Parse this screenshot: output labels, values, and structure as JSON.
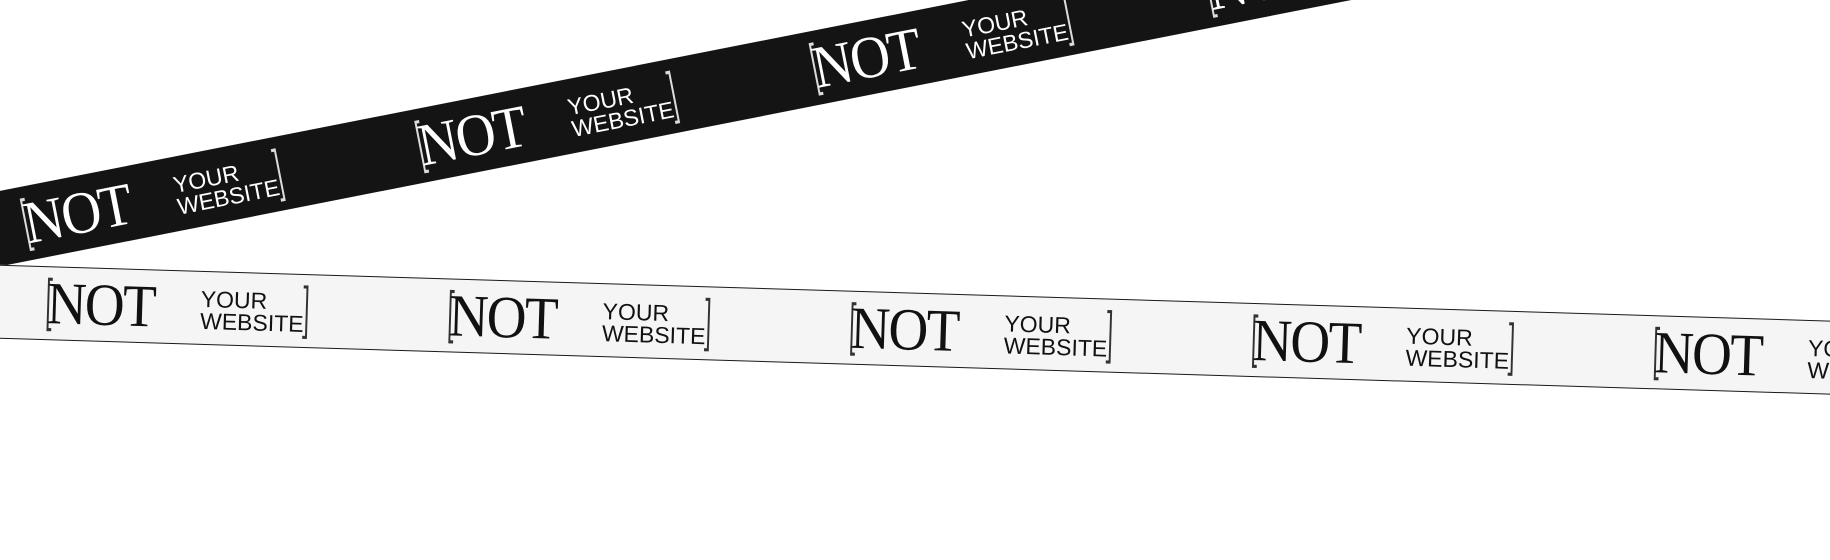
{
  "tape": {
    "not": "NOT",
    "your": "YOUR",
    "website": "WEBSITE",
    "bracket_open": "[",
    "bracket_close": "]"
  },
  "colors": {
    "background": "#ffffff",
    "dark_tape": "#141414",
    "dark_tape_text": "#ffffff",
    "light_tape": "#f5f5f5",
    "light_tape_text": "#111111"
  }
}
